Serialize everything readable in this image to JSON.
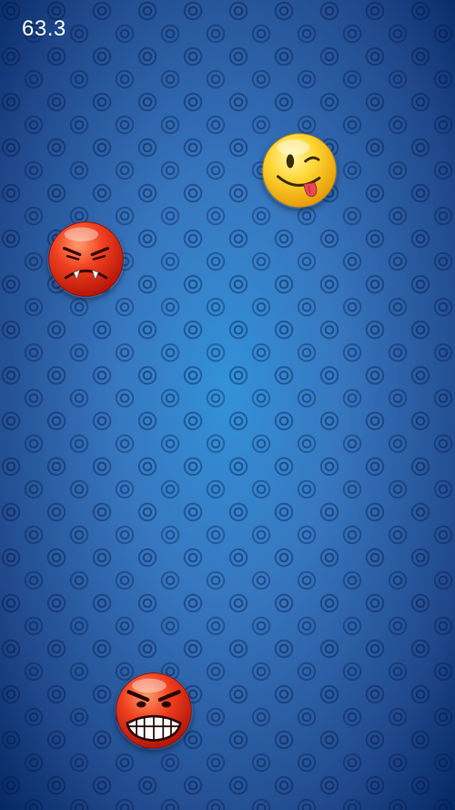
{
  "hud": {
    "timer": "63.3"
  },
  "emojis": [
    {
      "name": "winking-tongue-emoji",
      "color": "#f6c21a"
    },
    {
      "name": "angry-red-emoji",
      "color": "#e5321c"
    },
    {
      "name": "teeth-grinding-red-emoji",
      "color": "#e5321c"
    }
  ],
  "theme": {
    "background": "#1560b4",
    "text": "#ffffff"
  }
}
